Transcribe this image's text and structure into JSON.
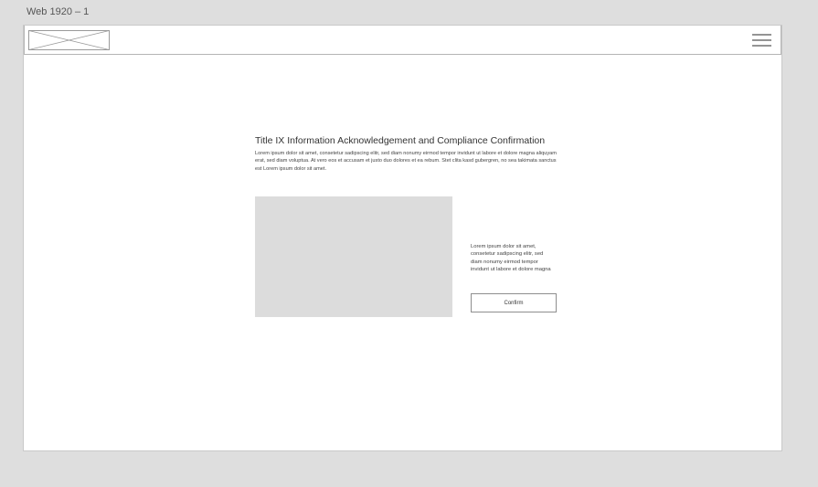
{
  "artboard": {
    "label": "Web 1920 – 1"
  },
  "header": {
    "logo_icon": "image-placeholder-icon",
    "menu_icon": "hamburger-menu-icon"
  },
  "main": {
    "title": "Title IX Information Acknowledgement and Compliance Confirmation",
    "description": "Lorem ipsum dolor sit amet, consetetur sadipscing elitr, sed diam nonumy eirmod tempor invidunt ut labore et dolore magna aliquyam erat, sed diam voluptua. At vero eos et accusam et justo duo dolores et ea rebum. Stet clita kasd gubergren, no sea takimata sanctus est Lorem ipsum dolor sit amet.",
    "side_text": "Lorem ipsum dolor sit amet, consetetur sadipscing elitr, sed diam nonumy eirmod tempor invidunt ut labore et dolore magna",
    "confirm_label": "Confirm"
  },
  "colors": {
    "canvas": "#dedede",
    "page": "#ffffff",
    "placeholder": "#dcdcdc",
    "border": "#b5b5b5"
  }
}
